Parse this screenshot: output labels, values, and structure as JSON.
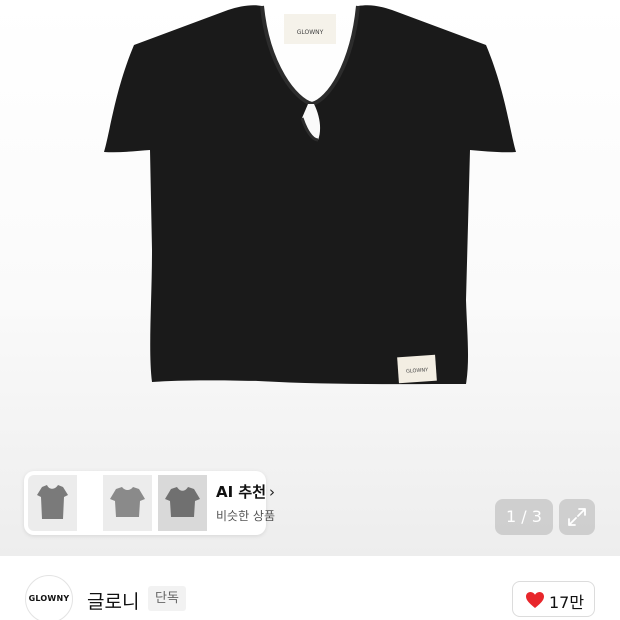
{
  "product": {
    "brand_tag": "GLOWNY",
    "hem_label": "GLOWNY"
  },
  "ai_recommend": {
    "title": "AI 추천",
    "chevron": "›",
    "subtitle": "비슷한 상품"
  },
  "gallery": {
    "current": 1,
    "total": 3,
    "counter_text": "1 / 3"
  },
  "brand": {
    "logo_text": "GLOWNY",
    "name": "글로니",
    "badge": "단독"
  },
  "like": {
    "count": "17만",
    "heart_color": "#e8262b"
  },
  "icons": [
    "heart-icon",
    "expand-icon",
    "chevron-right-icon"
  ]
}
